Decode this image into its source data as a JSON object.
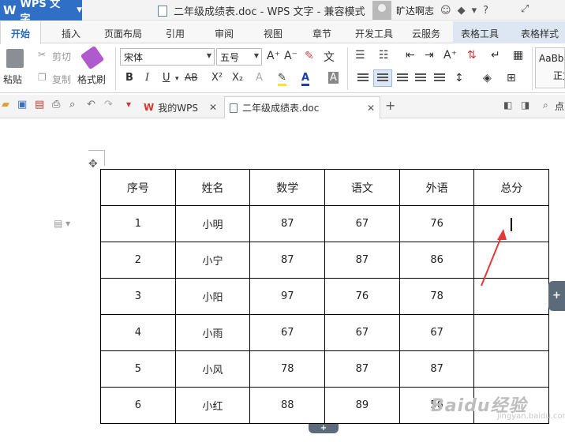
{
  "titlebar": {
    "app_name": "WPS 文字",
    "document_title": "二年级成绩表.doc - WPS 文字 - 兼容模式",
    "user_name": "旷达啊志"
  },
  "tabs": [
    "开始",
    "插入",
    "页面布局",
    "引用",
    "审阅",
    "视图",
    "章节",
    "开发工具",
    "云服务",
    "表格工具",
    "表格样式"
  ],
  "ribbon": {
    "paste": "粘贴",
    "cut": "剪切",
    "copy": "复制",
    "format_painter": "格式刷",
    "font_name": "宋体",
    "font_size": "五号",
    "style_preview": "AaBbC",
    "style_name": "正文"
  },
  "doc_tabs": {
    "home_tab": "我的WPS",
    "doc_tab": "二年级成绩表.doc",
    "search_label": "点"
  },
  "table": {
    "headers": [
      "序号",
      "姓名",
      "数学",
      "语文",
      "外语",
      "总分"
    ],
    "rows": [
      [
        "1",
        "小明",
        "87",
        "67",
        "76",
        ""
      ],
      [
        "2",
        "小宁",
        "87",
        "87",
        "86",
        ""
      ],
      [
        "3",
        "小阳",
        "97",
        "76",
        "78",
        ""
      ],
      [
        "4",
        "小雨",
        "67",
        "67",
        "67",
        ""
      ],
      [
        "5",
        "小风",
        "78",
        "87",
        "87",
        ""
      ],
      [
        "6",
        "小红",
        "88",
        "89",
        "56",
        ""
      ]
    ]
  },
  "watermark": "Baidu经验",
  "watermark_sub": "jingyan.baidu.com",
  "colors": {
    "accent": "#2f6fc5",
    "table_tools_tab": "#dde7f3",
    "annotation_arrow": "#e03a3a"
  }
}
